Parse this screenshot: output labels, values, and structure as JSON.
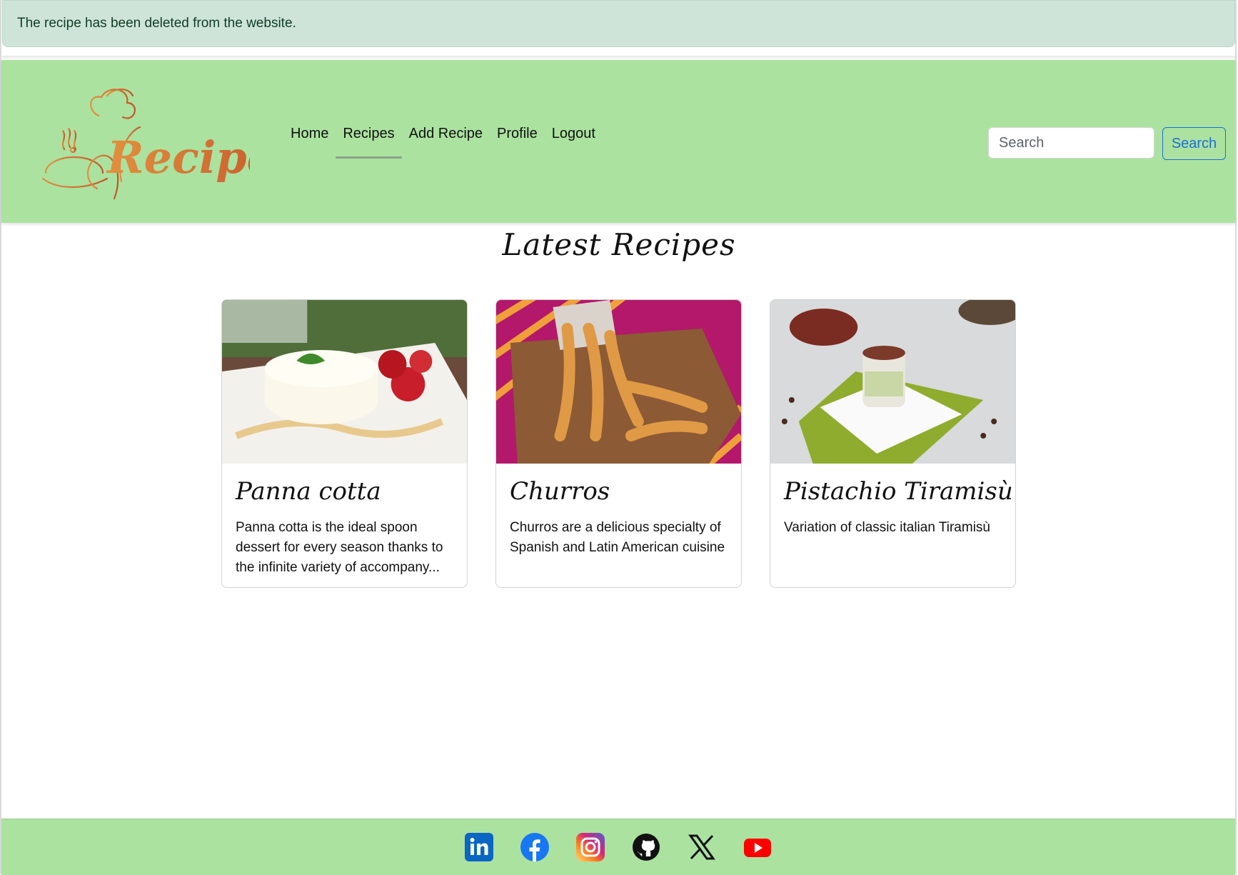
{
  "alert": {
    "message": "The recipe has been deleted from the website."
  },
  "brand": {
    "logo_text": "Recipes",
    "logo_colors": [
      "#e2913e",
      "#c2542a"
    ]
  },
  "nav": {
    "items": [
      {
        "label": "Home",
        "active": false
      },
      {
        "label": "Recipes",
        "active": true
      },
      {
        "label": "Add Recipe",
        "active": false
      },
      {
        "label": "Profile",
        "active": false
      },
      {
        "label": "Logout",
        "active": false
      }
    ]
  },
  "search": {
    "placeholder": "Search",
    "value": "",
    "button_label": "Search"
  },
  "main": {
    "heading": "Latest Recipes",
    "cards": [
      {
        "title": "Panna cotta",
        "text": "Panna cotta is the ideal spoon dessert for every season thanks to the infinite variety of accompany...",
        "image": "panna-cotta-photo"
      },
      {
        "title": "Churros",
        "text": "Churros are a delicious specialty of Spanish and Latin American cuisine",
        "image": "churros-photo"
      },
      {
        "title": "Pistachio Tiramisù",
        "text": "Variation of classic italian Tiramisù",
        "image": "pistachio-tiramisu-photo"
      }
    ]
  },
  "footer": {
    "icons": [
      "linkedin-icon",
      "facebook-icon",
      "instagram-icon",
      "github-icon",
      "x-icon",
      "youtube-icon"
    ]
  },
  "colors": {
    "navbar": "#abe2a0",
    "alert": "#cfe4d9",
    "alert_text": "#0f3d25",
    "primary": "#1c6ed6"
  }
}
